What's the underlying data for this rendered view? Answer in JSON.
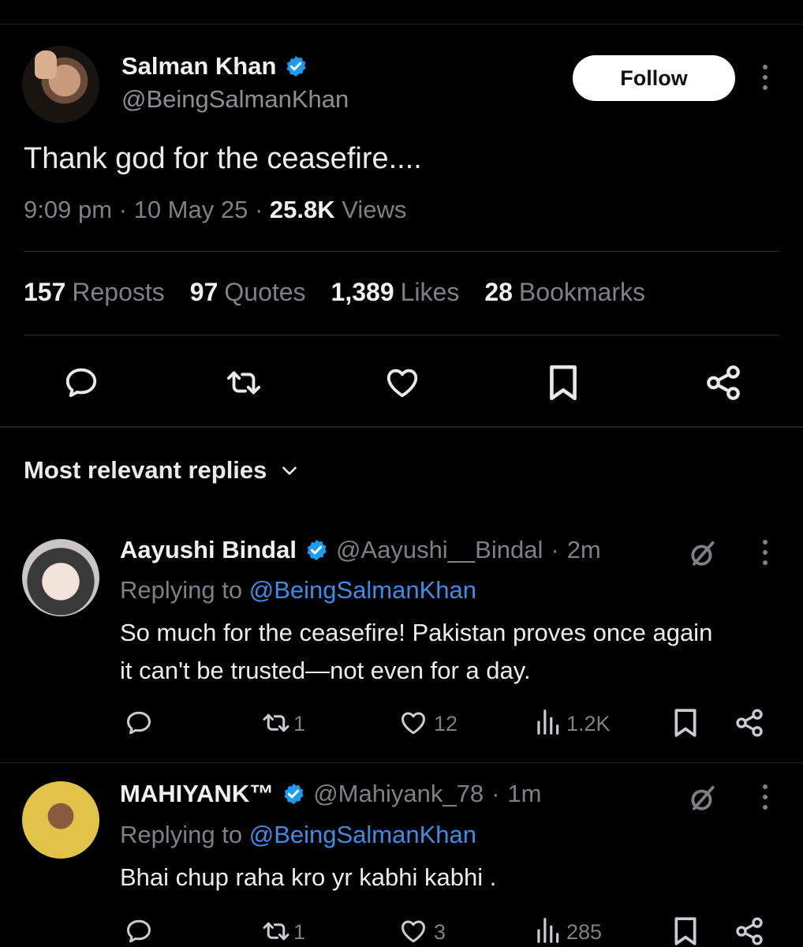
{
  "tweet": {
    "author": {
      "name": "Salman Khan",
      "handle": "@BeingSalmanKhan"
    },
    "follow_label": "Follow",
    "text": "Thank god for the ceasefire....",
    "time": "9:09 pm",
    "date": "10 May 25",
    "views_count": "25.8K",
    "views_label": "Views",
    "stats": [
      {
        "count": "157",
        "label": "Reposts"
      },
      {
        "count": "97",
        "label": "Quotes"
      },
      {
        "count": "1,389",
        "label": "Likes"
      },
      {
        "count": "28",
        "label": "Bookmarks"
      }
    ],
    "actions": [
      "reply-icon",
      "repost-icon",
      "like-icon",
      "bookmark-icon",
      "share-icon"
    ]
  },
  "replies_header": {
    "label": "Most relevant replies"
  },
  "replies": [
    {
      "name": "Aayushi Bindal",
      "handle": "@Aayushi__Bindal",
      "time": "2m",
      "replying_prefix": "Replying to ",
      "replying_to": "@BeingSalmanKhan",
      "text_line1": "So much for the ceasefire! Pakistan proves once again",
      "text_line2": "it can't be trusted—not even for a day.",
      "reposts": "1",
      "likes": "12",
      "views": "1.2K"
    },
    {
      "name": "MAHIYANK™",
      "handle": "@Mahiyank_78",
      "time": "1m",
      "replying_prefix": "Replying to ",
      "replying_to": "@BeingSalmanKhan",
      "text_line1": "Bhai chup raha kro yr kabhi kabhi .",
      "reposts": "1",
      "likes": "3",
      "views": "285"
    }
  ],
  "colors": {
    "background": "#000000",
    "accent": "#1d9bf0",
    "mention": "#3f8ce6",
    "muted": "#7d8186"
  }
}
